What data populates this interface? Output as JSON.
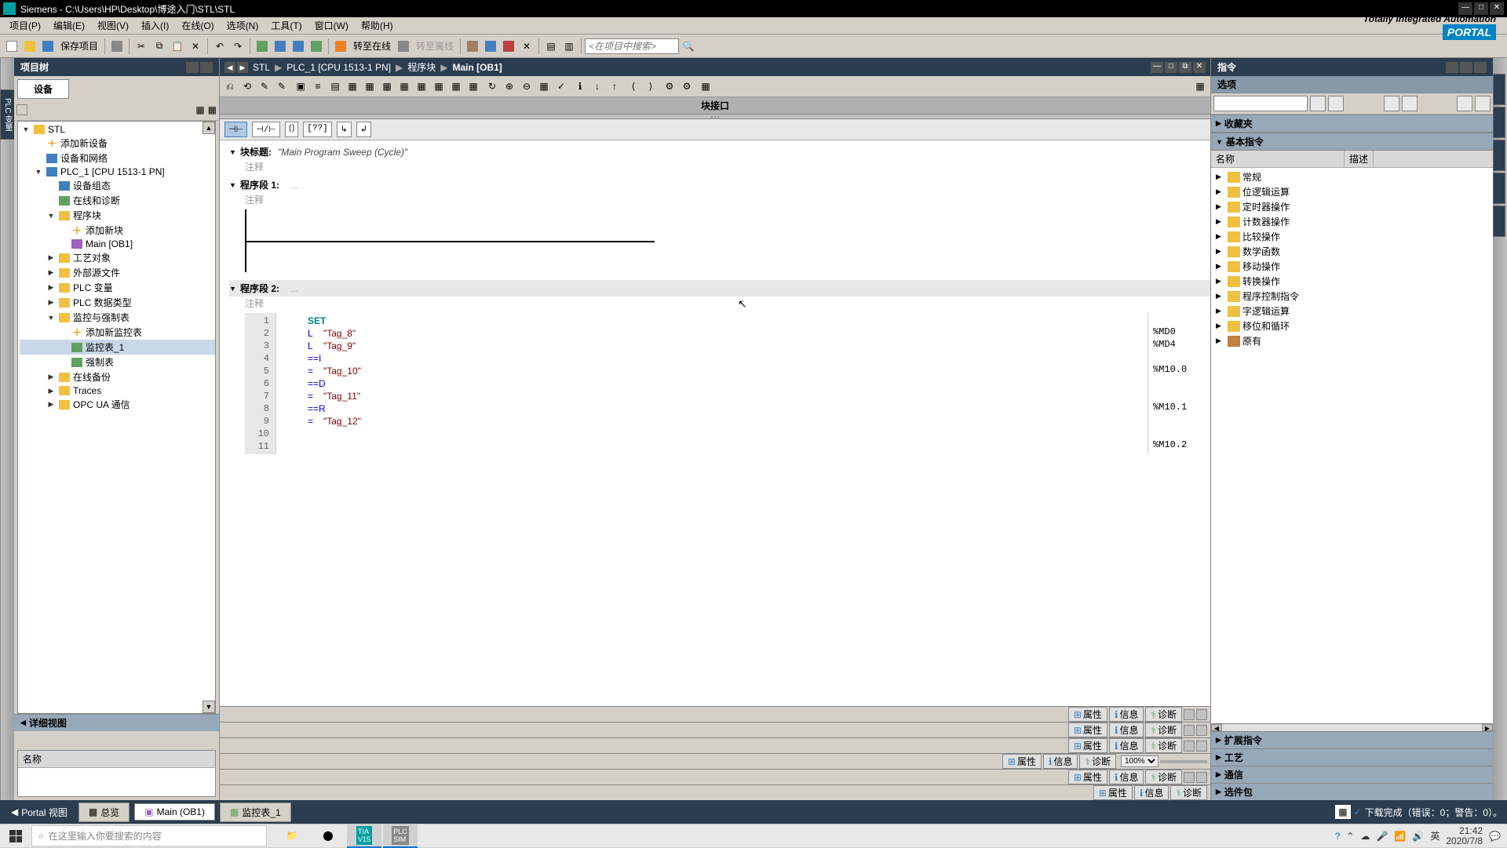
{
  "titlebar": {
    "app_name": "Siemens",
    "file_path": "C:\\Users\\HP\\Desktop\\博途入门\\STL\\STL"
  },
  "menubar": {
    "items": [
      "项目(P)",
      "编辑(E)",
      "视图(V)",
      "插入(I)",
      "在线(O)",
      "选项(N)",
      "工具(T)",
      "窗口(W)",
      "帮助(H)"
    ],
    "app_title": "Totally Integrated Automation",
    "portal": "PORTAL"
  },
  "toolbar": {
    "save_label": "保存项目",
    "go_online": "转至在线",
    "go_offline": "转至离线",
    "search_placeholder": "<在项目中搜索>"
  },
  "project_tree": {
    "header": "项目树",
    "device_tab": "设备",
    "nodes": [
      {
        "indent": 0,
        "expand": "▼",
        "icon": "folder",
        "label": "STL"
      },
      {
        "indent": 1,
        "expand": "",
        "icon": "add",
        "label": "添加新设备"
      },
      {
        "indent": 1,
        "expand": "",
        "icon": "device",
        "label": "设备和网络"
      },
      {
        "indent": 1,
        "expand": "▼",
        "icon": "device",
        "label": "PLC_1 [CPU 1513-1 PN]"
      },
      {
        "indent": 2,
        "expand": "",
        "icon": "device",
        "label": "设备组态"
      },
      {
        "indent": 2,
        "expand": "",
        "icon": "table",
        "label": "在线和诊断"
      },
      {
        "indent": 2,
        "expand": "▼",
        "icon": "folder",
        "label": "程序块"
      },
      {
        "indent": 3,
        "expand": "",
        "icon": "add",
        "label": "添加新块"
      },
      {
        "indent": 3,
        "expand": "",
        "icon": "block",
        "label": "Main [OB1]"
      },
      {
        "indent": 2,
        "expand": "▶",
        "icon": "folder",
        "label": "工艺对象"
      },
      {
        "indent": 2,
        "expand": "▶",
        "icon": "folder",
        "label": "外部源文件"
      },
      {
        "indent": 2,
        "expand": "▶",
        "icon": "folder",
        "label": "PLC 变量"
      },
      {
        "indent": 2,
        "expand": "▶",
        "icon": "folder",
        "label": "PLC 数据类型"
      },
      {
        "indent": 2,
        "expand": "▼",
        "icon": "folder",
        "label": "监控与强制表"
      },
      {
        "indent": 3,
        "expand": "",
        "icon": "add",
        "label": "添加新监控表"
      },
      {
        "indent": 3,
        "expand": "",
        "icon": "table",
        "label": "监控表_1",
        "selected": true
      },
      {
        "indent": 3,
        "expand": "",
        "icon": "table",
        "label": "强制表"
      },
      {
        "indent": 2,
        "expand": "▶",
        "icon": "folder",
        "label": "在线备份"
      },
      {
        "indent": 2,
        "expand": "▶",
        "icon": "folder",
        "label": "Traces"
      },
      {
        "indent": 2,
        "expand": "▶",
        "icon": "folder",
        "label": "OPC UA 通信"
      }
    ]
  },
  "detail_view": {
    "header": "详细视图",
    "column": "名称"
  },
  "left_side_tab": "PLC 变量",
  "editor": {
    "breadcrumb": [
      "STL",
      "PLC_1 [CPU 1513-1 PN]",
      "程序块",
      "Main [OB1]"
    ],
    "block_interface": "块接口",
    "block_title_label": "块标题:",
    "block_title_value": "\"Main Program Sweep (Cycle)\"",
    "comment_label": "注释",
    "network1_label": "程序段 1:",
    "network1_title": "",
    "network2_label": "程序段 2:",
    "network2_title": "",
    "stl_lines": [
      {
        "num": "1",
        "op": "SET",
        "arg": "",
        "addr": "",
        "keyword": true
      },
      {
        "num": "2",
        "op": "L",
        "arg": "\"Tag_8\"",
        "addr": "%MD0"
      },
      {
        "num": "3",
        "op": "L",
        "arg": "\"Tag_9\"",
        "addr": "%MD4"
      },
      {
        "num": "4",
        "op": "==I",
        "arg": "",
        "addr": ""
      },
      {
        "num": "5",
        "op": "=",
        "arg": "\"Tag_10\"",
        "addr": "%M10.0"
      },
      {
        "num": "6",
        "op": "",
        "arg": "",
        "addr": ""
      },
      {
        "num": "7",
        "op": "==D",
        "arg": "",
        "addr": ""
      },
      {
        "num": "8",
        "op": "=",
        "arg": "\"Tag_11\"",
        "addr": "%M10.1"
      },
      {
        "num": "9",
        "op": "",
        "arg": "",
        "addr": ""
      },
      {
        "num": "10",
        "op": "==R",
        "arg": "",
        "addr": ""
      },
      {
        "num": "11",
        "op": "=",
        "arg": "\"Tag_12\"",
        "addr": "%M10.2"
      }
    ],
    "bottom_tabs": {
      "prop": "属性",
      "info": "信息",
      "diag": "诊断"
    },
    "zoom": "100%"
  },
  "instructions": {
    "header": "指令",
    "options_header": "选项",
    "fav_header": "收藏夹",
    "basic_header": "基本指令",
    "col_name": "名称",
    "col_desc": "描述",
    "categories": [
      {
        "label": "常规"
      },
      {
        "label": "位逻辑运算"
      },
      {
        "label": "定时器操作"
      },
      {
        "label": "计数器操作"
      },
      {
        "label": "比较操作"
      },
      {
        "label": "数学函数"
      },
      {
        "label": "移动操作"
      },
      {
        "label": "转换操作"
      },
      {
        "label": "程序控制指令"
      },
      {
        "label": "字逻辑运算"
      },
      {
        "label": "移位和循环"
      },
      {
        "label": "原有",
        "etc": true
      }
    ],
    "collapsed_sections": [
      "扩展指令",
      "工艺",
      "通信",
      "选件包"
    ]
  },
  "statusbar": {
    "portal_view": "Portal 视图",
    "tabs": [
      {
        "label": "总览",
        "icon": "overview"
      },
      {
        "label": "Main (OB1)",
        "icon": "block",
        "active": true
      },
      {
        "label": "监控表_1",
        "icon": "table"
      }
    ],
    "status_msg": "下载完成（错误：0；警告：0）。"
  },
  "taskbar": {
    "search_placeholder": "在这里输入你要搜索的内容",
    "time": "21:42",
    "date": "2020/7/8",
    "ime": "英"
  }
}
